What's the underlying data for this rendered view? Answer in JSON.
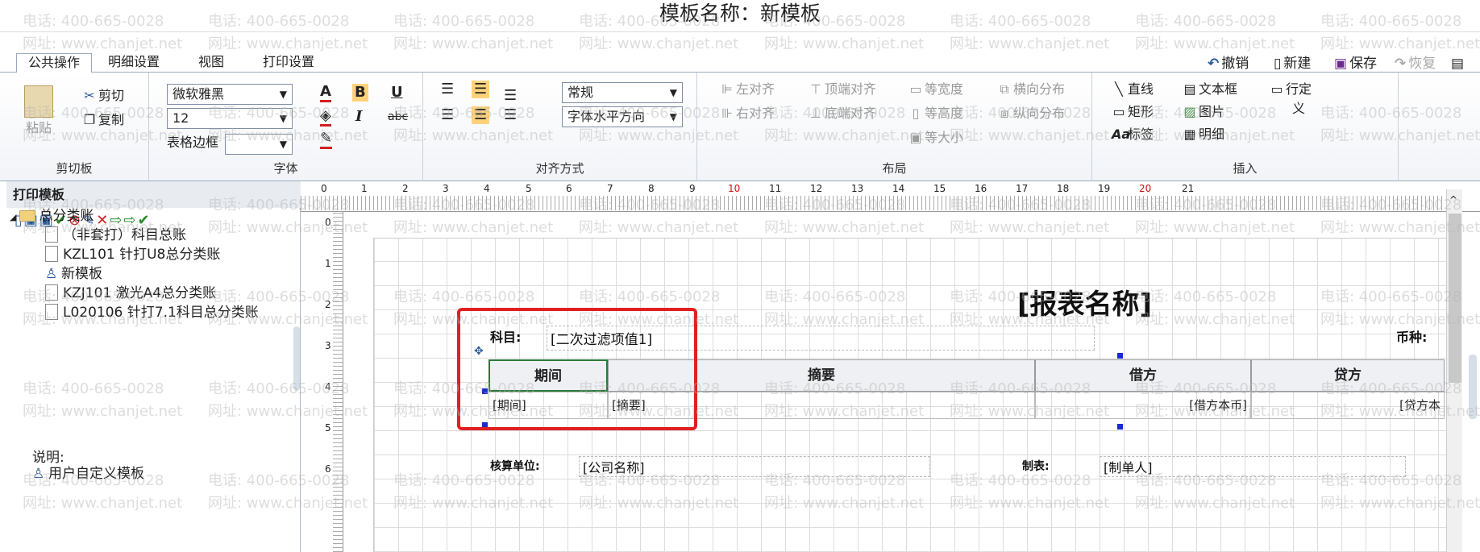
{
  "window": {
    "title": "模板名称：新模板"
  },
  "tabs": [
    "公共操作",
    "明细设置",
    "视图",
    "打印设置"
  ],
  "quick_actions": {
    "undo": "撤销",
    "new": "新建",
    "save": "保存",
    "redo": "恢复",
    "preview": "预"
  },
  "ribbon": {
    "clipboard": {
      "paste": "粘贴",
      "cut": "剪切",
      "copy": "复制",
      "label": "剪切板"
    },
    "font": {
      "family": "微软雅黑",
      "size": "12",
      "border_label": "表格边框",
      "bold": "B",
      "italic": "I",
      "underline": "U",
      "strike": "abc",
      "label": "字体"
    },
    "align": {
      "style": "常规",
      "direction": "字体水平方向",
      "label": "对齐方式"
    },
    "layout": {
      "left_align": "左对齐",
      "top_align": "顶端对齐",
      "equal_width": "等宽度",
      "h_distribute": "横向分布",
      "right_align": "右对齐",
      "bottom_align": "底端对齐",
      "equal_height": "等高度",
      "v_distribute": "纵向分布",
      "equal_size": "等大小",
      "label": "布局"
    },
    "insert": {
      "line": "直线",
      "textbox": "文本框",
      "row_def": "行定",
      "row_def2": "义",
      "rect": "矩形",
      "image": "图片",
      "label_btn": "标签",
      "detail": "明细",
      "label": "插入"
    }
  },
  "left_panel": {
    "title": "打印模板",
    "tree_root": "总分类账",
    "items": [
      "（非套打）科目总账",
      "KZL101 针打U8总分类账",
      "新模板",
      "KZJ101 激光A4总分类账",
      "L020106 针打7.1科目总分类账"
    ],
    "note_label": "说明:",
    "note_item": "用户自定义模板"
  },
  "ruler": {
    "h": [
      "0",
      "1",
      "2",
      "3",
      "4",
      "5",
      "6",
      "7",
      "8",
      "9",
      "10",
      "11",
      "12",
      "13",
      "14",
      "15",
      "16",
      "17",
      "18",
      "19",
      "20",
      "21"
    ],
    "v": [
      "0",
      "1",
      "2",
      "3",
      "4",
      "5",
      "6"
    ]
  },
  "report": {
    "title": "[报表名称]",
    "subject_label": "科目:",
    "subject_value": "[二次过滤项值1]",
    "currency_label": "币种:",
    "headers": [
      "期间",
      "摘要",
      "借方",
      "贷方"
    ],
    "row": [
      "[期间]",
      "[摘要]",
      "[借方本币]",
      "[贷方本"
    ],
    "unit_label": "核算单位:",
    "unit_value": "[公司名称]",
    "maker_label": "制表:",
    "maker_value": "[制单人]"
  },
  "watermark": {
    "phone": "电话: 400-665-0028",
    "site": "网址: www.chanjet.net"
  },
  "colors": {
    "highlight_box": "#e02020",
    "accent": "#2a5a9a",
    "ruler_red": "#d01010"
  }
}
